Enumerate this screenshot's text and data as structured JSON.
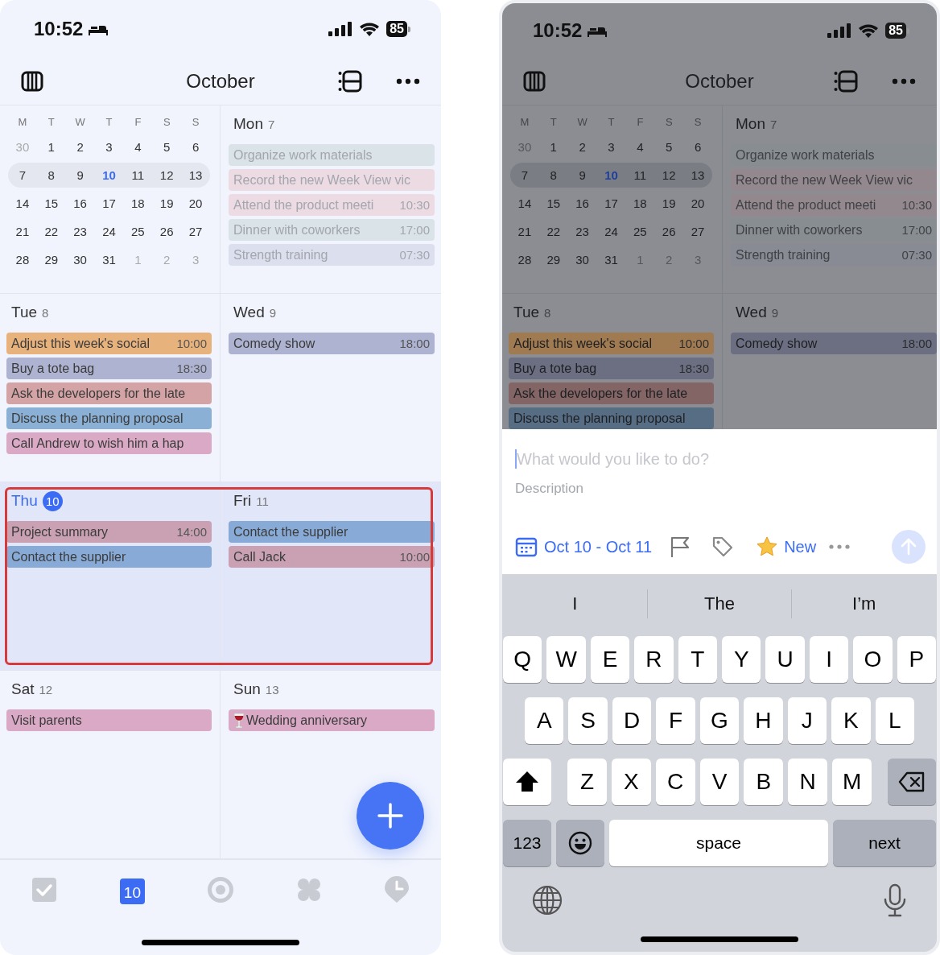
{
  "screens": [
    {
      "dimmed": false,
      "status_bar": {
        "time": "10:52",
        "battery": "85"
      },
      "header": {
        "title": "October"
      },
      "mini_calendar": {
        "weekdays": [
          "M",
          "T",
          "W",
          "T",
          "F",
          "S",
          "S"
        ],
        "weeks": [
          {
            "selected": false,
            "days": [
              {
                "label": "30",
                "muted": true,
                "today": false
              },
              {
                "label": "1",
                "muted": false,
                "today": false
              },
              {
                "label": "2",
                "muted": false,
                "today": false
              },
              {
                "label": "3",
                "muted": false,
                "today": false
              },
              {
                "label": "4",
                "muted": false,
                "today": false
              },
              {
                "label": "5",
                "muted": false,
                "today": false
              },
              {
                "label": "6",
                "muted": false,
                "today": false
              }
            ]
          },
          {
            "selected": true,
            "days": [
              {
                "label": "7",
                "muted": false,
                "today": false
              },
              {
                "label": "8",
                "muted": false,
                "today": false
              },
              {
                "label": "9",
                "muted": false,
                "today": false
              },
              {
                "label": "10",
                "muted": false,
                "today": true
              },
              {
                "label": "11",
                "muted": false,
                "today": false
              },
              {
                "label": "12",
                "muted": false,
                "today": false
              },
              {
                "label": "13",
                "muted": false,
                "today": false
              }
            ]
          },
          {
            "selected": false,
            "days": [
              {
                "label": "14",
                "muted": false,
                "today": false
              },
              {
                "label": "15",
                "muted": false,
                "today": false
              },
              {
                "label": "16",
                "muted": false,
                "today": false
              },
              {
                "label": "17",
                "muted": false,
                "today": false
              },
              {
                "label": "18",
                "muted": false,
                "today": false
              },
              {
                "label": "19",
                "muted": false,
                "today": false
              },
              {
                "label": "20",
                "muted": false,
                "today": false
              }
            ]
          },
          {
            "selected": false,
            "days": [
              {
                "label": "21",
                "muted": false,
                "today": false
              },
              {
                "label": "22",
                "muted": false,
                "today": false
              },
              {
                "label": "23",
                "muted": false,
                "today": false
              },
              {
                "label": "24",
                "muted": false,
                "today": false
              },
              {
                "label": "25",
                "muted": false,
                "today": false
              },
              {
                "label": "26",
                "muted": false,
                "today": false
              },
              {
                "label": "27",
                "muted": false,
                "today": false
              }
            ]
          },
          {
            "selected": false,
            "days": [
              {
                "label": "28",
                "muted": false,
                "today": false
              },
              {
                "label": "29",
                "muted": false,
                "today": false
              },
              {
                "label": "30",
                "muted": false,
                "today": false
              },
              {
                "label": "31",
                "muted": false,
                "today": false
              },
              {
                "label": "1",
                "muted": true,
                "today": false
              },
              {
                "label": "2",
                "muted": true,
                "today": false
              },
              {
                "label": "3",
                "muted": true,
                "today": false
              }
            ]
          }
        ]
      },
      "rows": [
        {
          "highlighted": false,
          "outlined": false,
          "days": [
            {
              "name": "Mon",
              "date": "7",
              "today": false,
              "past": true,
              "events": [
                {
                  "title": "Organize work materials",
                  "color": "#d9e3e8"
                },
                {
                  "title": "Record the new Week View vic",
                  "color": "#eddbe3"
                },
                {
                  "title": "Attend the product meeti",
                  "time": "10:30",
                  "color": "#eddbe3"
                },
                {
                  "title": "Dinner with coworkers",
                  "time": "17:00",
                  "color": "#d9e3e8"
                },
                {
                  "title": "Strength training",
                  "time": "07:30",
                  "color": "#dcdfee"
                }
              ]
            }
          ]
        },
        {
          "highlighted": false,
          "outlined": false,
          "days": [
            {
              "name": "Tue",
              "date": "8",
              "today": false,
              "past": false,
              "events": [
                {
                  "title": "Adjust this week's social",
                  "time": "10:00",
                  "color": "#e8b27c"
                },
                {
                  "title": "Buy a tote bag",
                  "time": "18:30",
                  "color": "#aeb3d2"
                },
                {
                  "title": "Ask the developers for the late",
                  "color": "#d4a3a5"
                },
                {
                  "title": "Discuss the planning proposal",
                  "color": "#8ab0d5"
                },
                {
                  "title": "Call Andrew to wish him a hap",
                  "color": "#d9a9c5"
                }
              ]
            },
            {
              "name": "Wed",
              "date": "9",
              "today": false,
              "past": false,
              "events": [
                {
                  "title": "Comedy show",
                  "time": "18:00",
                  "color": "#aeb3d2"
                }
              ]
            }
          ]
        },
        {
          "highlighted": true,
          "outlined": true,
          "days": [
            {
              "name": "Thu",
              "date": "10",
              "today": true,
              "past": false,
              "events": [
                {
                  "title": "Project summary",
                  "time": "14:00",
                  "color": "#c9a1b3"
                },
                {
                  "title": "Contact the supplier",
                  "color": "#88aad6"
                }
              ]
            },
            {
              "name": "Fri",
              "date": "11",
              "today": false,
              "past": false,
              "events": [
                {
                  "title": "Contact the supplier",
                  "color": "#88aad6"
                },
                {
                  "title": "Call Jack",
                  "time": "10:00",
                  "color": "#c9a1b3"
                }
              ]
            }
          ]
        },
        {
          "highlighted": false,
          "outlined": false,
          "days": [
            {
              "name": "Sat",
              "date": "12",
              "today": false,
              "past": false,
              "events": [
                {
                  "title": "Visit parents",
                  "color": "#d9a9c5"
                }
              ]
            },
            {
              "name": "Sun",
              "date": "13",
              "today": false,
              "past": false,
              "events": [
                {
                  "title": "Wedding anniversary",
                  "has_icon": true,
                  "color": "#d9a9c5"
                }
              ]
            }
          ]
        }
      ],
      "fab": true,
      "tab_bar": [
        {
          "kind": "tasks",
          "selected": false
        },
        {
          "kind": "calendar",
          "label": "10",
          "selected": true
        },
        {
          "kind": "focus",
          "selected": false
        },
        {
          "kind": "apps",
          "selected": false
        },
        {
          "kind": "clock",
          "selected": false
        }
      ]
    },
    {
      "dimmed": true,
      "status_bar": {
        "time": "10:52",
        "battery": "85"
      },
      "header": {
        "title": "October"
      },
      "mini_calendar": {
        "weekdays": [
          "M",
          "T",
          "W",
          "T",
          "F",
          "S",
          "S"
        ],
        "weeks": [
          {
            "selected": false,
            "days": [
              {
                "label": "30",
                "muted": true,
                "today": false
              },
              {
                "label": "1",
                "muted": false,
                "today": false
              },
              {
                "label": "2",
                "muted": false,
                "today": false
              },
              {
                "label": "3",
                "muted": false,
                "today": false
              },
              {
                "label": "4",
                "muted": false,
                "today": false
              },
              {
                "label": "5",
                "muted": false,
                "today": false
              },
              {
                "label": "6",
                "muted": false,
                "today": false
              }
            ]
          },
          {
            "selected": true,
            "days": [
              {
                "label": "7",
                "muted": false,
                "today": false
              },
              {
                "label": "8",
                "muted": false,
                "today": false
              },
              {
                "label": "9",
                "muted": false,
                "today": false
              },
              {
                "label": "10",
                "muted": false,
                "today": true
              },
              {
                "label": "11",
                "muted": false,
                "today": false
              },
              {
                "label": "12",
                "muted": false,
                "today": false
              },
              {
                "label": "13",
                "muted": false,
                "today": false
              }
            ]
          },
          {
            "selected": false,
            "days": [
              {
                "label": "14",
                "muted": false,
                "today": false
              },
              {
                "label": "15",
                "muted": false,
                "today": false
              },
              {
                "label": "16",
                "muted": false,
                "today": false
              },
              {
                "label": "17",
                "muted": false,
                "today": false
              },
              {
                "label": "18",
                "muted": false,
                "today": false
              },
              {
                "label": "19",
                "muted": false,
                "today": false
              },
              {
                "label": "20",
                "muted": false,
                "today": false
              }
            ]
          },
          {
            "selected": false,
            "days": [
              {
                "label": "21",
                "muted": false,
                "today": false
              },
              {
                "label": "22",
                "muted": false,
                "today": false
              },
              {
                "label": "23",
                "muted": false,
                "today": false
              },
              {
                "label": "24",
                "muted": false,
                "today": false
              },
              {
                "label": "25",
                "muted": false,
                "today": false
              },
              {
                "label": "26",
                "muted": false,
                "today": false
              },
              {
                "label": "27",
                "muted": false,
                "today": false
              }
            ]
          },
          {
            "selected": false,
            "days": [
              {
                "label": "28",
                "muted": false,
                "today": false
              },
              {
                "label": "29",
                "muted": false,
                "today": false
              },
              {
                "label": "30",
                "muted": false,
                "today": false
              },
              {
                "label": "31",
                "muted": false,
                "today": false
              },
              {
                "label": "1",
                "muted": true,
                "today": false
              },
              {
                "label": "2",
                "muted": true,
                "today": false
              },
              {
                "label": "3",
                "muted": true,
                "today": false
              }
            ]
          }
        ]
      },
      "rows": [
        {
          "highlighted": false,
          "outlined": false,
          "days": [
            {
              "name": "Mon",
              "date": "7",
              "today": false,
              "past": true,
              "events": [
                {
                  "title": "Organize work materials",
                  "color": "#878d90"
                },
                {
                  "title": "Record the new Week View vic",
                  "color": "#93888d"
                },
                {
                  "title": "Attend the product meeti",
                  "time": "10:30",
                  "color": "#93888d"
                },
                {
                  "title": "Dinner with coworkers",
                  "time": "17:00",
                  "color": "#878d90"
                },
                {
                  "title": "Strength training",
                  "time": "07:30",
                  "color": "#888a94"
                }
              ]
            }
          ]
        },
        {
          "highlighted": false,
          "outlined": false,
          "days": [
            {
              "name": "Tue",
              "date": "8",
              "today": false,
              "past": false,
              "events": [
                {
                  "title": "Adjust this week's social",
                  "time": "10:00",
                  "color": "#a07a50"
                },
                {
                  "title": "Buy a tote bag",
                  "time": "18:30",
                  "color": "#6c6f82"
                },
                {
                  "title": "Ask the developers for the late",
                  "color": "#836566"
                },
                {
                  "title": "Discuss the planning proposal",
                  "color": "#566d84"
                }
              ]
            },
            {
              "name": "Wed",
              "date": "9",
              "today": false,
              "past": false,
              "events": [
                {
                  "title": "Comedy show",
                  "time": "18:00",
                  "color": "#6c6f82"
                }
              ]
            }
          ]
        }
      ],
      "compose": {
        "title_placeholder": "What would you like to do?",
        "description_placeholder": "Description",
        "date_range": "Oct 10 - Oct 11",
        "list_label": "New"
      },
      "keyboard": {
        "suggestions": [
          "I",
          "The",
          "I’m"
        ],
        "rows": [
          [
            "Q",
            "W",
            "E",
            "R",
            "T",
            "Y",
            "U",
            "I",
            "O",
            "P"
          ],
          [
            "A",
            "S",
            "D",
            "F",
            "G",
            "H",
            "J",
            "K",
            "L"
          ],
          [
            "Z",
            "X",
            "C",
            "V",
            "B",
            "N",
            "M"
          ]
        ],
        "number_key": "123",
        "space_key": "space",
        "return_key": "next"
      }
    }
  ]
}
